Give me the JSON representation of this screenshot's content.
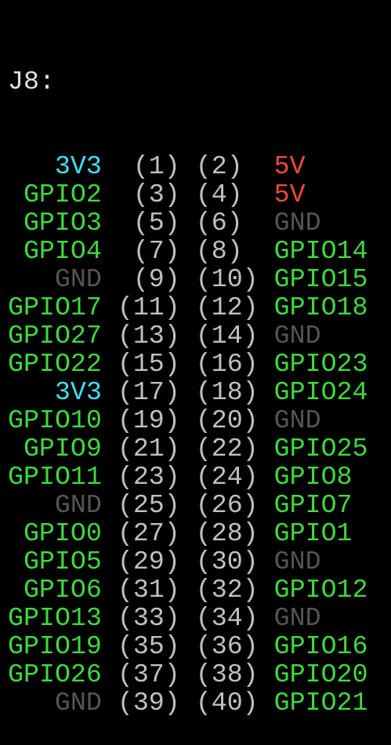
{
  "header": "J8:",
  "colors": {
    "gpio": "#3fd83f",
    "power33": "#3ee0f2",
    "power5": "#f0483a",
    "ground": "#555555",
    "pin": "#c0c0c0",
    "header": "#e0e0e0"
  },
  "rows": [
    {
      "left": "3V3",
      "lpin": "(1)",
      "rpin": "(2)",
      "right": "5V"
    },
    {
      "left": "GPIO2",
      "lpin": "(3)",
      "rpin": "(4)",
      "right": "5V"
    },
    {
      "left": "GPIO3",
      "lpin": "(5)",
      "rpin": "(6)",
      "right": "GND"
    },
    {
      "left": "GPIO4",
      "lpin": "(7)",
      "rpin": "(8)",
      "right": "GPIO14"
    },
    {
      "left": "GND",
      "lpin": "(9)",
      "rpin": "(10)",
      "right": "GPIO15"
    },
    {
      "left": "GPIO17",
      "lpin": "(11)",
      "rpin": "(12)",
      "right": "GPIO18"
    },
    {
      "left": "GPIO27",
      "lpin": "(13)",
      "rpin": "(14)",
      "right": "GND"
    },
    {
      "left": "GPIO22",
      "lpin": "(15)",
      "rpin": "(16)",
      "right": "GPIO23"
    },
    {
      "left": "3V3",
      "lpin": "(17)",
      "rpin": "(18)",
      "right": "GPIO24"
    },
    {
      "left": "GPIO10",
      "lpin": "(19)",
      "rpin": "(20)",
      "right": "GND"
    },
    {
      "left": "GPIO9",
      "lpin": "(21)",
      "rpin": "(22)",
      "right": "GPIO25"
    },
    {
      "left": "GPIO11",
      "lpin": "(23)",
      "rpin": "(24)",
      "right": "GPIO8"
    },
    {
      "left": "GND",
      "lpin": "(25)",
      "rpin": "(26)",
      "right": "GPIO7"
    },
    {
      "left": "GPIO0",
      "lpin": "(27)",
      "rpin": "(28)",
      "right": "GPIO1"
    },
    {
      "left": "GPIO5",
      "lpin": "(29)",
      "rpin": "(30)",
      "right": "GND"
    },
    {
      "left": "GPIO6",
      "lpin": "(31)",
      "rpin": "(32)",
      "right": "GPIO12"
    },
    {
      "left": "GPIO13",
      "lpin": "(33)",
      "rpin": "(34)",
      "right": "GND"
    },
    {
      "left": "GPIO19",
      "lpin": "(35)",
      "rpin": "(36)",
      "right": "GPIO16"
    },
    {
      "left": "GPIO26",
      "lpin": "(37)",
      "rpin": "(38)",
      "right": "GPIO20"
    },
    {
      "left": "GND",
      "lpin": "(39)",
      "rpin": "(40)",
      "right": "GPIO21"
    }
  ]
}
